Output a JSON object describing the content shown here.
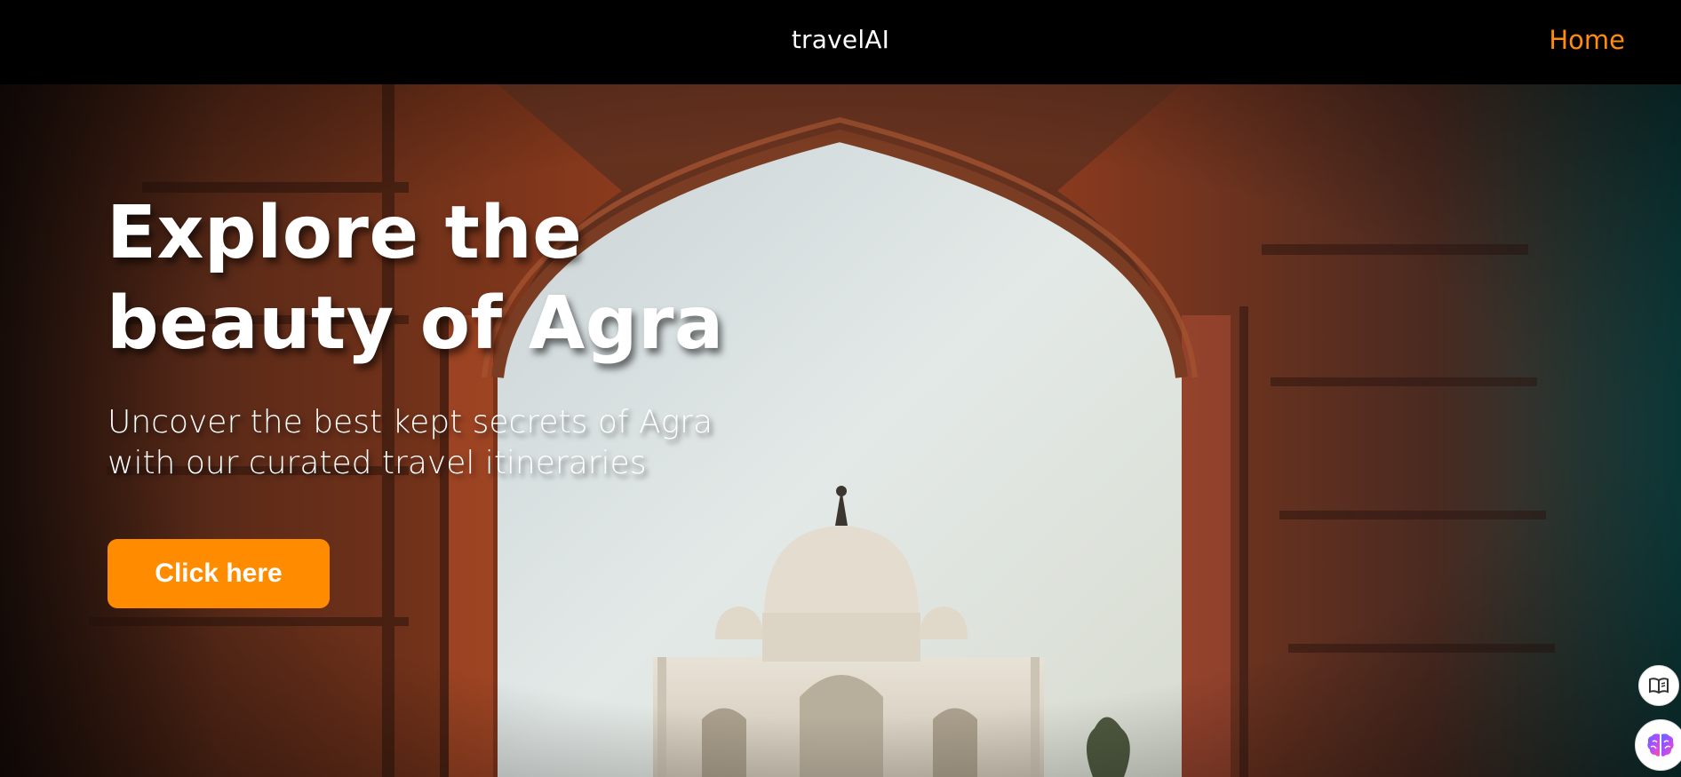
{
  "header": {
    "brand": "travelAI",
    "nav_home": "Home"
  },
  "hero": {
    "headline_line1": "Explore the",
    "headline_line2": "beauty of Agra",
    "subheadline_line1": "Uncover the best kept secrets of Agra",
    "subheadline_line2": "with our curated travel itineraries",
    "cta_label": "Click here",
    "background_image": "Taj Mahal seen through a carved red sandstone archway"
  },
  "floating_widgets": {
    "reader_icon": "book-reader-icon",
    "ai_icon": "brain-icon"
  },
  "colors": {
    "accent": "#ff8c00",
    "nav_bg": "#000000",
    "text": "#ffffff"
  }
}
